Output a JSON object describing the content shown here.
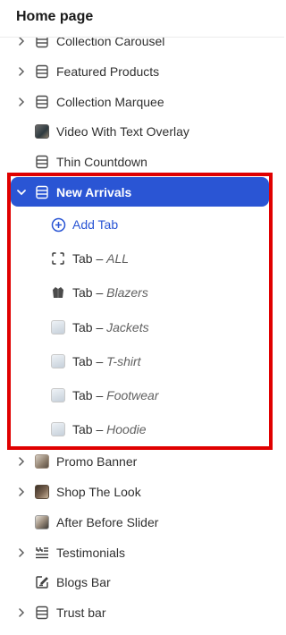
{
  "header": {
    "title": "Home page"
  },
  "sections": [
    {
      "label": "Collection Carousel",
      "expandable": true,
      "icon": "section-icon"
    },
    {
      "label": "Featured Products",
      "expandable": true,
      "icon": "section-icon"
    },
    {
      "label": "Collection Marquee",
      "expandable": true,
      "icon": "section-icon"
    },
    {
      "label": "Video With Text Overlay",
      "expandable": false,
      "icon": "image-thumbnail-icon"
    },
    {
      "label": "Thin Countdown",
      "expandable": false,
      "icon": "section-icon"
    }
  ],
  "selected_section": {
    "label": "New Arrivals",
    "expanded": true,
    "icon": "section-icon"
  },
  "tabs_block": {
    "add_label": "Add Tab",
    "prefix": "Tab – ",
    "items": [
      {
        "name": "ALL",
        "icon": "dashed-square-icon"
      },
      {
        "name": "Blazers",
        "icon": "jacket-thumbnail-icon"
      },
      {
        "name": "Jackets",
        "icon": "image-placeholder-icon"
      },
      {
        "name": "T-shirt",
        "icon": "image-placeholder-icon"
      },
      {
        "name": "Footwear",
        "icon": "image-placeholder-icon"
      },
      {
        "name": "Hoodie",
        "icon": "image-placeholder-icon"
      }
    ]
  },
  "sections_after": [
    {
      "label": "Promo Banner",
      "expandable": true,
      "icon": "image-thumbnail-icon"
    },
    {
      "label": "Shop The Look",
      "expandable": true,
      "icon": "image-thumbnail-icon"
    },
    {
      "label": "After Before Slider",
      "expandable": false,
      "icon": "image-thumbnail-icon"
    },
    {
      "label": "Testimonials",
      "expandable": true,
      "icon": "quote-list-icon"
    },
    {
      "label": "Blogs Bar",
      "expandable": false,
      "icon": "edit-note-icon"
    },
    {
      "label": "Trust bar",
      "expandable": true,
      "icon": "section-icon"
    }
  ],
  "colors": {
    "accent": "#2a55d4",
    "highlight_border": "#e00000",
    "text": "#303030",
    "muted": "#616161"
  }
}
